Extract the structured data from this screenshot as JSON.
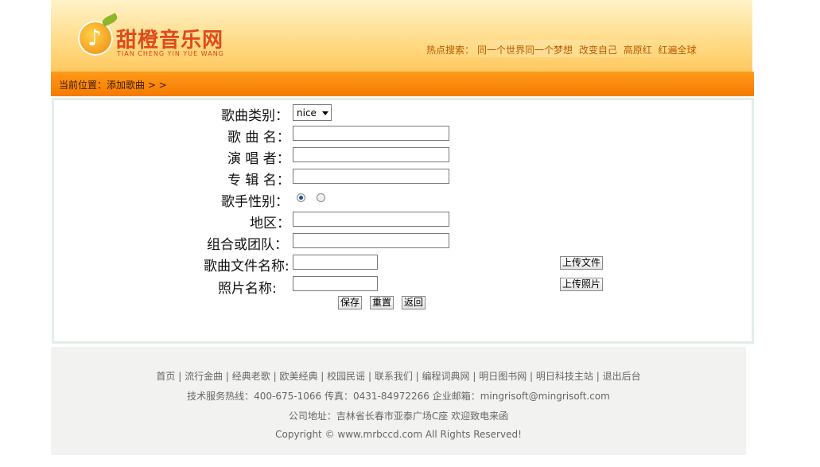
{
  "header": {
    "logo_text": "甜橙音乐网",
    "logo_pinyin": "TIAN CHENG YIN YUE WANG",
    "hot_search_label": "热点搜索：",
    "hot_search_items": [
      "同一个世界同一个梦想",
      "改变自己",
      "高原红",
      "红遍全球"
    ]
  },
  "nav": {
    "breadcrumb": "当前位置：添加歌曲 > >"
  },
  "form": {
    "category_label": "歌曲类别：",
    "category_value": "nice",
    "song_name_label": "歌 曲 名：",
    "song_name_value": "",
    "singer_label": "演 唱 者：",
    "singer_value": "",
    "album_label": "专 辑 名：",
    "album_value": "",
    "gender_label": "歌手性别：",
    "gender_selected": "first",
    "region_label": "地区：",
    "region_value": "",
    "group_label": "组合或团队：",
    "group_value": "",
    "file_label": "歌曲文件名称:",
    "file_value": "",
    "upload_file_button": "上传文件",
    "photo_label": "照片名称:",
    "photo_value": "",
    "upload_photo_button": "上传照片",
    "save_button": "保存",
    "reset_button": "重置",
    "back_button": "返回"
  },
  "footer": {
    "links": [
      "首页",
      "流行金曲",
      "经典老歌",
      "欧美经典",
      "校园民谣",
      "联系我们",
      "编程词典网",
      "明日图书网",
      "明日科技主站",
      "退出后台"
    ],
    "support_line": "技术服务热线：400-675-1066 传真：0431-84972266 企业邮箱：mingrisoft@mingrisoft.com",
    "address_line": "公司地址：吉林省长春市亚泰广场C座 欢迎致电来函",
    "copyright": "Copyright © www.mrbccd.com All Rights Reserved!"
  }
}
